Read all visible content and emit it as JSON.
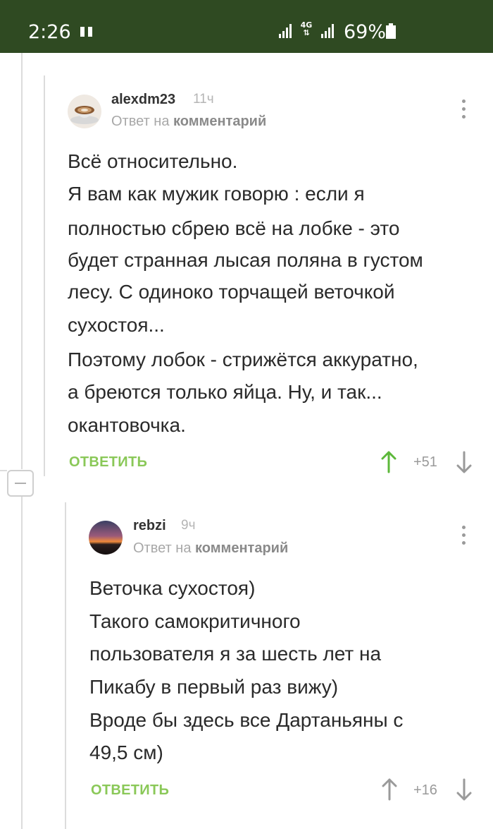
{
  "status_bar": {
    "time": "2:26",
    "network": "4G",
    "battery": "69%"
  },
  "comments": [
    {
      "username": "alexdm23",
      "time": "11ч",
      "reply_prefix": "Ответ на",
      "reply_target": "комментарий",
      "lines": [
        "Всё относительно.",
        "Я вам как мужик говорю : если я",
        "полностью сбрею всё на лобке - это",
        "будет странная лысая поляна в густом",
        "лесу. С одиноко торчащей веточкой",
        "сухостоя...",
        "Поэтому лобок - стрижётся аккуратно,",
        "а бреются только яйца. Ну, и так...",
        "окантовочка."
      ],
      "reply_label": "ОТВЕТИТЬ",
      "score": "+51",
      "avatar_icon": "coffee-cup-avatar",
      "upvote_color": "#5cb83a"
    },
    {
      "username": "rebzi",
      "time": "9ч",
      "reply_prefix": "Ответ на",
      "reply_target": "комментарий",
      "lines": [
        "Веточка сухостоя)",
        "Такого самокритичного",
        "пользователя я за шесть лет на",
        "Пикабу в первый раз вижу)",
        "Вроде бы здесь все Дартаньяны с",
        "49,5 см)"
      ],
      "reply_label": "ОТВЕТИТЬ",
      "score": "+16",
      "avatar_icon": "sunset-avatar",
      "upvote_color": "#9a9a9a"
    }
  ],
  "colors": {
    "status_bar": "#2f4a22",
    "reply_green": "#8ac858",
    "thread_line": "#dcdcdc"
  }
}
